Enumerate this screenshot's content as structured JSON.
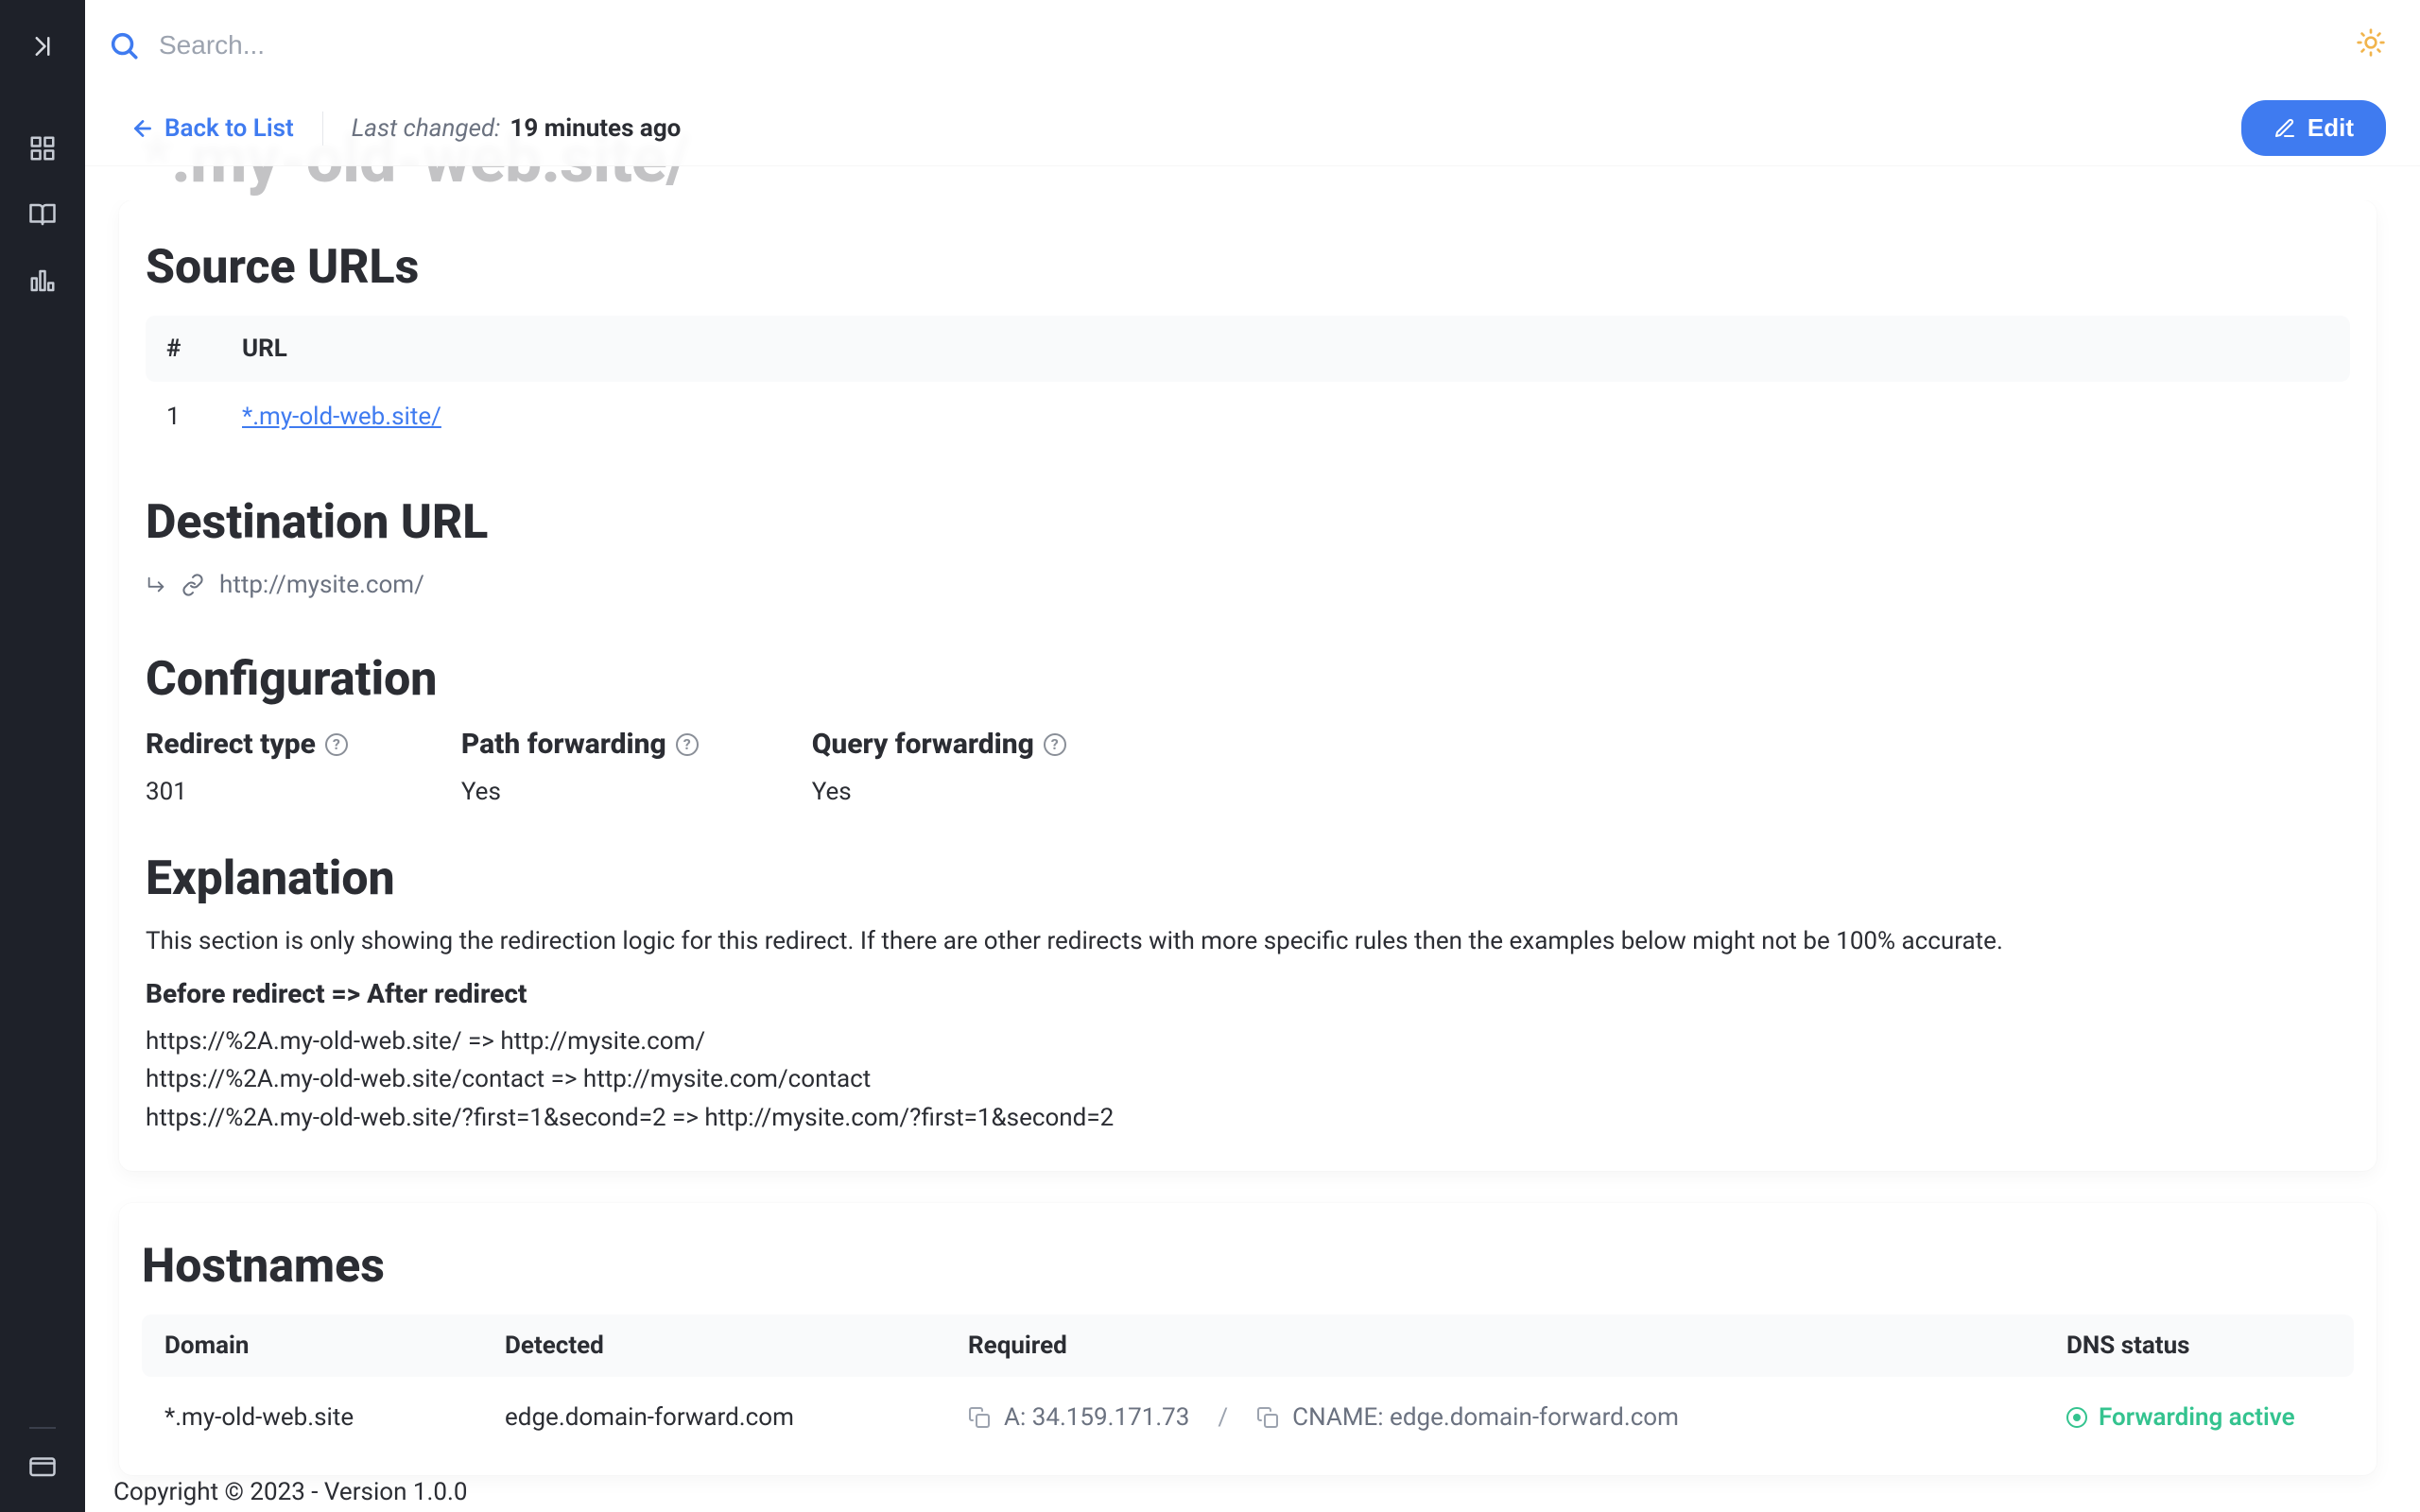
{
  "search": {
    "placeholder": "Search..."
  },
  "toolbar": {
    "back_label": "Back to List",
    "last_changed_label": "Last changed:",
    "last_changed_value": "19 minutes ago",
    "edit_label": "Edit"
  },
  "page_title_ghost": "*.my-old-web.site/",
  "source_urls": {
    "title": "Source URLs",
    "headers": {
      "index": "#",
      "url": "URL"
    },
    "rows": [
      {
        "index": "1",
        "url": "*.my-old-web.site/"
      }
    ]
  },
  "destination_url": {
    "title": "Destination URL",
    "value": "http://mysite.com/"
  },
  "configuration": {
    "title": "Configuration",
    "items": [
      {
        "label": "Redirect type",
        "value": "301"
      },
      {
        "label": "Path forwarding",
        "value": "Yes"
      },
      {
        "label": "Query forwarding",
        "value": "Yes"
      }
    ]
  },
  "explanation": {
    "title": "Explanation",
    "text": "This section is only showing the redirection logic for this redirect. If there are other redirects with more specific rules then the examples below might not be 100% accurate.",
    "subheading": "Before redirect => After redirect",
    "examples": "https://%2A.my-old-web.site/ => http://mysite.com/\nhttps://%2A.my-old-web.site/contact => http://mysite.com/contact\nhttps://%2A.my-old-web.site/?first=1&second=2 => http://mysite.com/?first=1&second=2"
  },
  "hostnames": {
    "title": "Hostnames",
    "headers": {
      "domain": "Domain",
      "detected": "Detected",
      "required": "Required",
      "dns_status": "DNS status"
    },
    "rows": [
      {
        "domain": "*.my-old-web.site",
        "detected": "edge.domain-forward.com",
        "required_a_label": "A:",
        "required_a_value": "34.159.171.73",
        "required_sep": "/",
        "required_cname_label": "CNAME:",
        "required_cname_value": "edge.domain-forward.com",
        "dns_status": "Forwarding active"
      }
    ]
  },
  "footer": "Copyright © 2023 - Version 1.0.0"
}
